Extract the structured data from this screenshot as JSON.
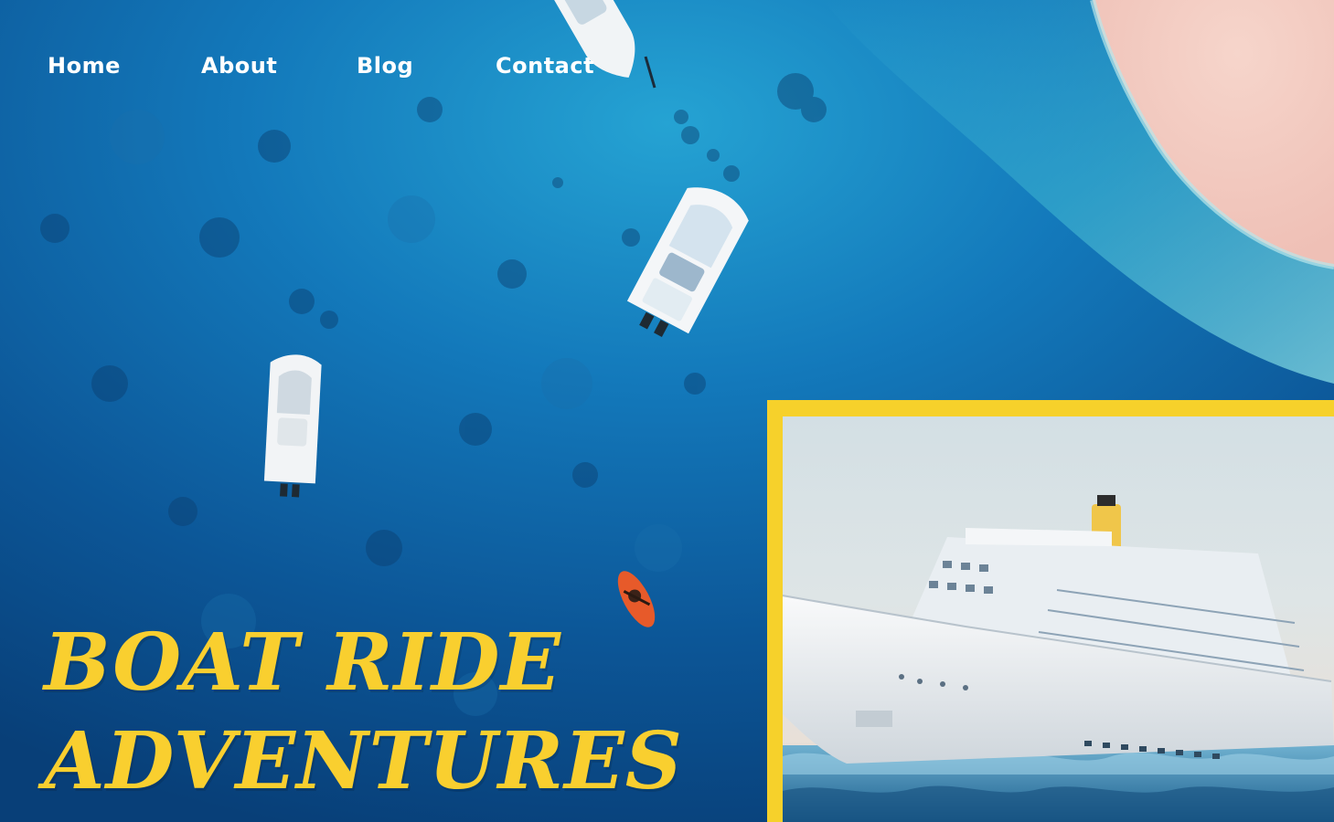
{
  "nav": {
    "items": [
      {
        "label": "Home"
      },
      {
        "label": "About"
      },
      {
        "label": "Blog"
      },
      {
        "label": "Contact"
      }
    ]
  },
  "hero": {
    "title_line1": "Boat Ride",
    "title_line2": "Adventures"
  },
  "colors": {
    "accent": "#f6d12b",
    "ocean": "#0c4f8f",
    "sand": "#f3c9c1"
  }
}
